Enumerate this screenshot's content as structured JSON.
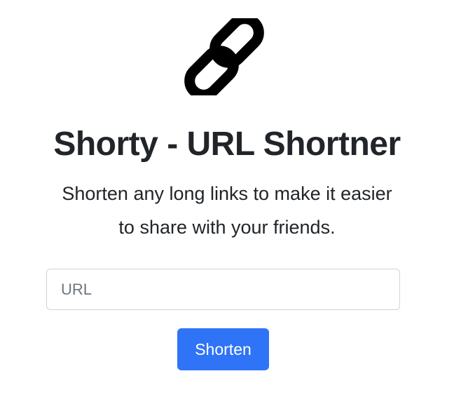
{
  "logo": {
    "icon": "link-icon"
  },
  "header": {
    "title": "Shorty - URL Shortner",
    "subtitle": "Shorten any long links to make it easier to share with your friends."
  },
  "form": {
    "url_placeholder": "URL",
    "url_value": "",
    "submit_label": "Shorten"
  },
  "colors": {
    "primary": "#2f74f6",
    "text": "#212529",
    "placeholder": "#6c757d",
    "input_border": "#ced4da"
  }
}
